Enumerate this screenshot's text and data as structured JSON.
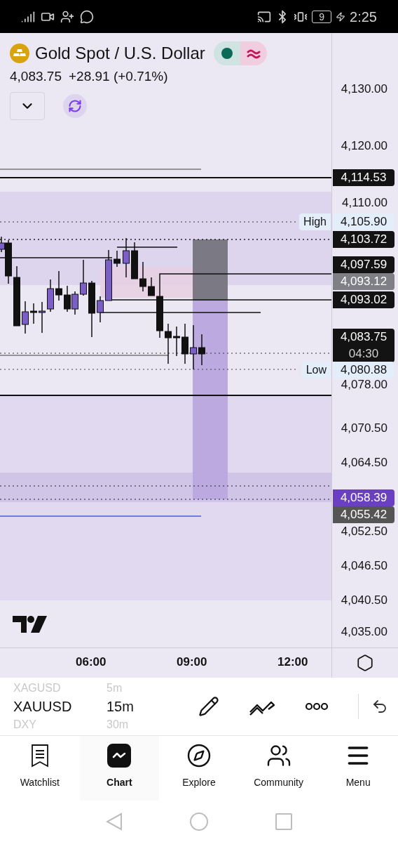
{
  "status_bar": {
    "time": "2:25",
    "battery": "9"
  },
  "symbol": {
    "title": "Gold Spot / U.S. Dollar",
    "price": "4,083.75",
    "change": "+28.91 (+0.71%)",
    "market_open": true
  },
  "price_axis": [
    {
      "kind": "tick",
      "label": "4,130.00"
    },
    {
      "kind": "tick",
      "label": "4,120.00"
    },
    {
      "kind": "tag",
      "label": "4,114.53",
      "color": "#131313"
    },
    {
      "kind": "tick",
      "label": "4,110.00"
    },
    {
      "kind": "extreme",
      "label": "4,105.90",
      "note": "High",
      "color": "#e3eefa"
    },
    {
      "kind": "tag",
      "label": "4,103.72",
      "color": "#131313"
    },
    {
      "kind": "tag",
      "label": "4,097.59",
      "color": "#131313"
    },
    {
      "kind": "tag",
      "label": "4,093.12",
      "color": "#7f7f86"
    },
    {
      "kind": "tag",
      "label": "4,093.02",
      "color": "#131313"
    },
    {
      "kind": "tag",
      "label": "4,083.75",
      "sublabel": "04:30",
      "color": "#131313"
    },
    {
      "kind": "extreme",
      "label": "4,080.88",
      "note": "Low",
      "color": "#e3eefa"
    },
    {
      "kind": "tick",
      "label": "4,078.00"
    },
    {
      "kind": "tick",
      "label": "4,070.50"
    },
    {
      "kind": "tick",
      "label": "4,064.50"
    },
    {
      "kind": "tag",
      "label": "4,058.39",
      "color": "#6a3fc1"
    },
    {
      "kind": "tag",
      "label": "4,055.42",
      "color": "#555555"
    },
    {
      "kind": "tick",
      "label": "4,052.50"
    },
    {
      "kind": "tick",
      "label": "4,046.50"
    },
    {
      "kind": "tick",
      "label": "4,040.50"
    },
    {
      "kind": "tick",
      "label": "4,035.00"
    }
  ],
  "time_axis": [
    "06:00",
    "09:00",
    "12:00"
  ],
  "symbols": [
    {
      "symbol": "XAGUSD",
      "interval": "5m",
      "selected": false
    },
    {
      "symbol": "XAUUSD",
      "interval": "15m",
      "selected": true
    },
    {
      "symbol": "DXY",
      "interval": "30m",
      "selected": false
    }
  ],
  "nav": [
    {
      "label": "Watchlist",
      "selected": false
    },
    {
      "label": "Chart",
      "selected": true
    },
    {
      "label": "Explore",
      "selected": false
    },
    {
      "label": "Community",
      "selected": false
    },
    {
      "label": "Menu",
      "selected": false
    }
  ]
}
